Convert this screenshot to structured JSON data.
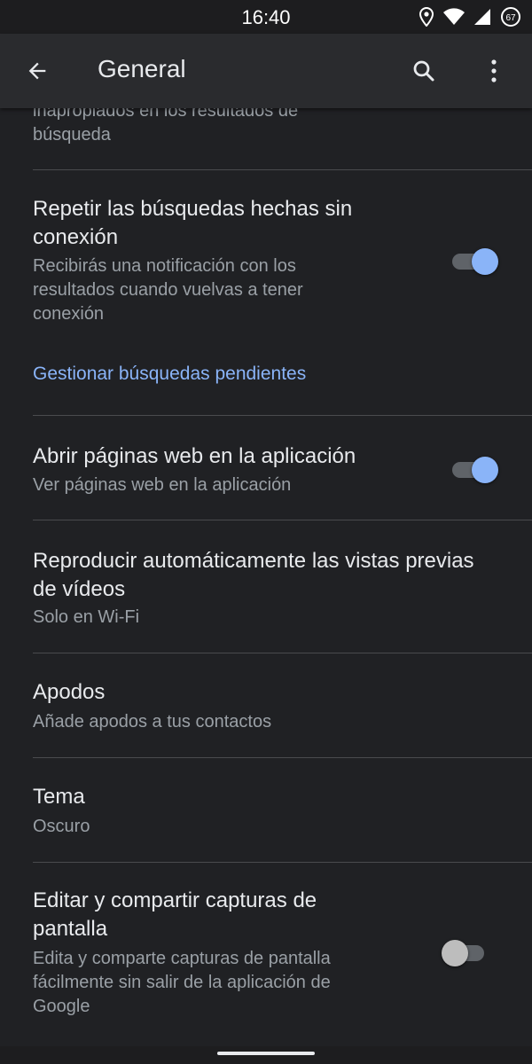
{
  "status_bar": {
    "time": "16:40",
    "battery": "67"
  },
  "app_bar": {
    "title": "General"
  },
  "settings": {
    "partial_summary": "inapropiados en los resultados de\nbúsqueda",
    "offline": {
      "title": "Repetir las búsquedas hechas sin\nconexión",
      "summary": "Recibirás una notificación con los\nresultados cuando vuelvas a tener\nconexión",
      "enabled": true,
      "link": "Gestionar búsquedas pendientes"
    },
    "open_in_app": {
      "title": "Abrir páginas web en la aplicación",
      "summary": "Ver páginas web en la aplicación",
      "enabled": true
    },
    "autoplay": {
      "title": "Reproducir automáticamente las vistas previas\nde vídeos",
      "summary": "Solo en Wi-Fi"
    },
    "nicknames": {
      "title": "Apodos",
      "summary": "Añade apodos a tus contactos"
    },
    "theme": {
      "title": "Tema",
      "summary": "Oscuro"
    },
    "screenshots": {
      "title": "Editar y compartir capturas de\npantalla",
      "summary": "Edita y comparte capturas de pantalla\nfácilmente sin salir de la aplicación de\nGoogle",
      "enabled": false
    }
  },
  "colors": {
    "accent": "#8ab4f8",
    "background": "#202124",
    "app_bar": "#2a2b2e",
    "secondary_text": "#9aa0a6"
  },
  "icons": [
    "location-icon",
    "wifi-icon",
    "cell-signal-icon",
    "battery-saver-icon",
    "back-arrow-icon",
    "search-icon",
    "more-vert-icon"
  ]
}
